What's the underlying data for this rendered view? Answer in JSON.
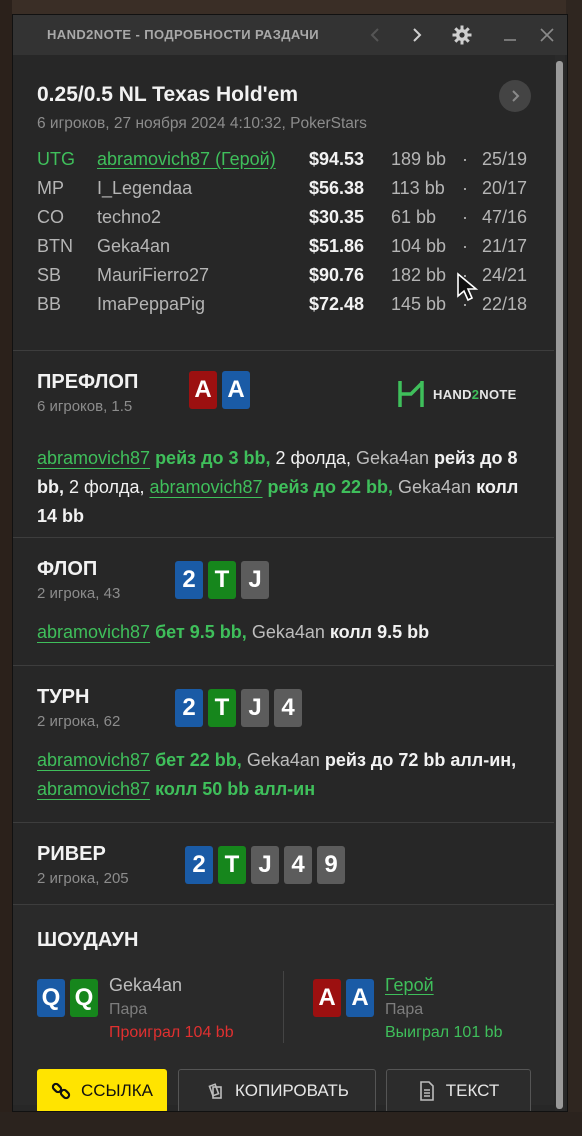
{
  "window": {
    "title": "HAND2NOTE - ПОДРОБНОСТИ РАЗДАЧИ"
  },
  "icons": {
    "prev": "chevron-left-icon",
    "next": "chevron-right-icon",
    "settings": "gear-icon",
    "minimize": "minimize-icon",
    "close": "close-icon"
  },
  "hand": {
    "title": "0.25/0.5 NL Texas Hold'em",
    "subtitle": "6 игроков, 27 ноября 2024 4:10:32, PokerStars",
    "players": [
      {
        "pos": "UTG",
        "name": "abramovich87 (Герой)",
        "stack": "$94.53",
        "bb": "189 bb",
        "dot": "·",
        "stat": "25/19",
        "hero": true
      },
      {
        "pos": "MP",
        "name": "I_Legendaa",
        "stack": "$56.38",
        "bb": "113 bb",
        "dot": "·",
        "stat": "20/17",
        "hero": false
      },
      {
        "pos": "CO",
        "name": "techno2",
        "stack": "$30.35",
        "bb": "61 bb",
        "dot": "·",
        "stat": "47/16",
        "hero": false
      },
      {
        "pos": "BTN",
        "name": "Geka4an",
        "stack": "$51.86",
        "bb": "104 bb",
        "dot": "·",
        "stat": "21/17",
        "hero": false
      },
      {
        "pos": "SB",
        "name": "MauriFierro27",
        "stack": "$90.76",
        "bb": "182 bb",
        "dot": "·",
        "stat": "24/21",
        "hero": false
      },
      {
        "pos": "BB",
        "name": "ImaPeppaPig",
        "stack": "$72.48",
        "bb": "145 bb",
        "dot": "·",
        "stat": "22/18",
        "hero": false
      }
    ]
  },
  "logo": {
    "text_a": "HAND",
    "text_b": "2",
    "text_c": "NOTE",
    "color_accent": "#3fbf5b"
  },
  "streets": {
    "preflop": {
      "title": "ПРЕФЛОП",
      "subtitle": "6 игроков, 1.5",
      "cards": [
        {
          "r": "A",
          "c": "red"
        },
        {
          "r": "A",
          "c": "blue"
        }
      ],
      "actions": [
        {
          "t": "abramovich87",
          "k": "name"
        },
        {
          "t": " рейз до 3 bb,",
          "k": "g"
        },
        {
          "t": " 2 фолда, ",
          "k": "w"
        },
        {
          "t": "Geka4an",
          "k": "opp"
        },
        {
          "t": " рейз до 8 bb,",
          "k": "b"
        },
        {
          "t": " 2 фолда, ",
          "k": "w"
        },
        {
          "t": "abramovich87",
          "k": "name"
        },
        {
          "t": " рейз до 22 bb,",
          "k": "g"
        },
        {
          "t": " ",
          "k": "w"
        },
        {
          "t": "Geka4an",
          "k": "opp"
        },
        {
          "t": " колл 14 bb",
          "k": "b"
        }
      ]
    },
    "flop": {
      "title": "ФЛОП",
      "subtitle": "2 игрока, 43",
      "cards": [
        {
          "r": "2",
          "c": "blue"
        },
        {
          "r": "T",
          "c": "green"
        },
        {
          "r": "J",
          "c": "grey"
        }
      ],
      "actions": [
        {
          "t": "abramovich87",
          "k": "name"
        },
        {
          "t": " бет 9.5 bb,",
          "k": "g"
        },
        {
          "t": " ",
          "k": "w"
        },
        {
          "t": "Geka4an",
          "k": "opp"
        },
        {
          "t": " колл 9.5 bb",
          "k": "b"
        }
      ]
    },
    "turn": {
      "title": "ТУРН",
      "subtitle": "2 игрока, 62",
      "cards": [
        {
          "r": "2",
          "c": "blue"
        },
        {
          "r": "T",
          "c": "green"
        },
        {
          "r": "J",
          "c": "grey"
        },
        {
          "r": "4",
          "c": "grey"
        }
      ],
      "actions": [
        {
          "t": "abramovich87",
          "k": "name"
        },
        {
          "t": " бет 22 bb,",
          "k": "g"
        },
        {
          "t": " ",
          "k": "w"
        },
        {
          "t": "Geka4an",
          "k": "opp"
        },
        {
          "t": " рейз до 72 bb алл-ин,",
          "k": "b"
        },
        {
          "t": " ",
          "k": "w"
        },
        {
          "t": "abramovich87",
          "k": "name"
        },
        {
          "t": " колл 50 bb алл-ин",
          "k": "g"
        }
      ]
    },
    "river": {
      "title": "РИВЕР",
      "subtitle": "2 игрока, 205",
      "cards": [
        {
          "r": "2",
          "c": "blue"
        },
        {
          "r": "T",
          "c": "green"
        },
        {
          "r": "J",
          "c": "grey"
        },
        {
          "r": "4",
          "c": "grey"
        },
        {
          "r": "9",
          "c": "grey"
        }
      ]
    }
  },
  "showdown": {
    "title": "ШОУДАУН",
    "villain": {
      "cards": [
        {
          "r": "Q",
          "c": "blue"
        },
        {
          "r": "Q",
          "c": "green"
        }
      ],
      "name": "Geka4an",
      "hand": "Пара",
      "result": "Проиграл 104 bb"
    },
    "hero": {
      "cards": [
        {
          "r": "A",
          "c": "red"
        },
        {
          "r": "A",
          "c": "blue"
        }
      ],
      "name": "Герой",
      "hand": "Пара",
      "result": "Выиграл 101 bb"
    }
  },
  "buttons": {
    "link": "ССЫЛКА",
    "copy": "КОПИРОВАТЬ",
    "text": "ТЕКСТ"
  },
  "colors": {
    "link_button": "#ffe400",
    "win": "#3fbf5b",
    "lose": "#e03030",
    "card_red": "#9c1010",
    "card_blue": "#1a5ba6",
    "card_green": "#16861c",
    "card_grey": "#5c5c5c"
  }
}
